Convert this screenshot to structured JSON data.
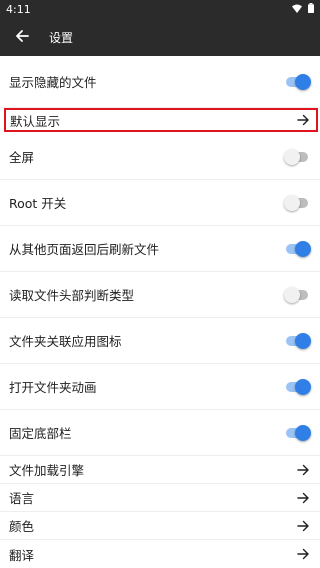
{
  "status_bar": {
    "time": "4:11"
  },
  "toolbar": {
    "title": "设置",
    "back_icon": "arrow-left-icon"
  },
  "colors": {
    "accent": "#2f7fe6",
    "bar": "#2b2b2b",
    "highlight_border": "#e0141e"
  },
  "settings": {
    "show_hidden": {
      "label": "显示隐藏的文件",
      "enabled": true
    },
    "default_display": {
      "label": "默认显示"
    },
    "fullscreen": {
      "label": "全屏",
      "enabled": false
    },
    "root_switch": {
      "label": "Root 开关",
      "enabled": false
    },
    "refresh_on_return": {
      "label": "从其他页面返回后刷新文件",
      "enabled": true
    },
    "read_header_type": {
      "label": "读取文件头部判断类型",
      "enabled": false
    },
    "folder_app_icon": {
      "label": "文件夹关联应用图标",
      "enabled": true
    },
    "folder_animation": {
      "label": "打开文件夹动画",
      "enabled": true
    },
    "fixed_bottom_bar": {
      "label": "固定底部栏",
      "enabled": true
    },
    "file_loader": {
      "label": "文件加载引擎"
    },
    "language": {
      "label": "语言"
    },
    "color": {
      "label": "颜色"
    },
    "translation": {
      "label": "翻译"
    }
  }
}
